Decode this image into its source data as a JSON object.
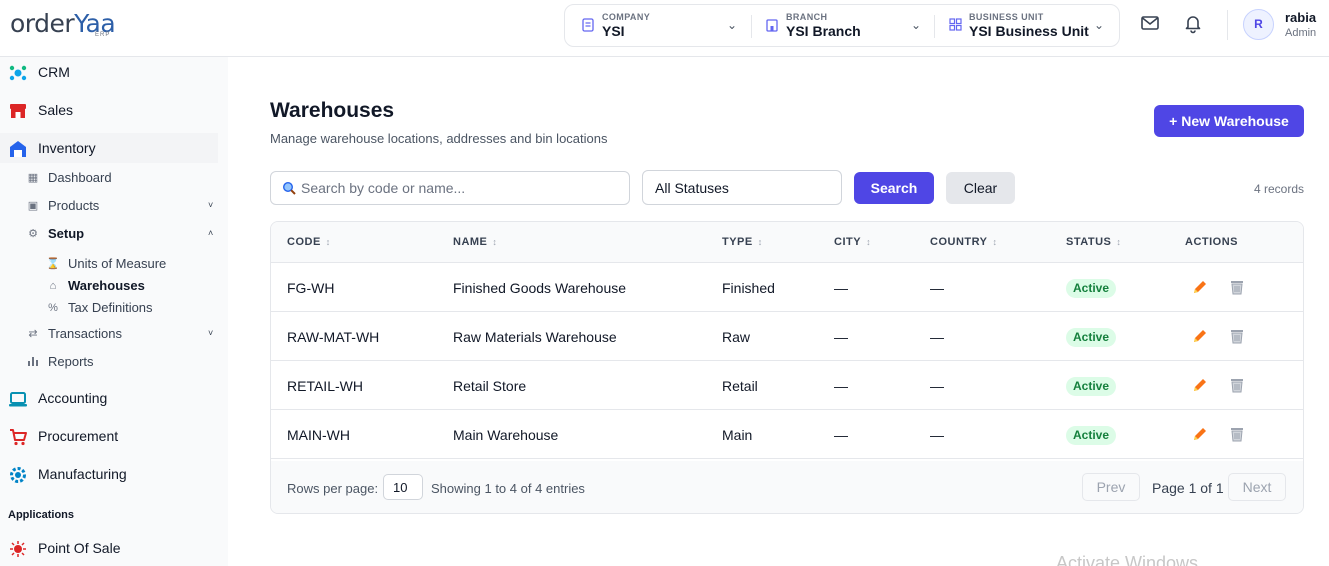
{
  "brand": {
    "logo_prefix": "order",
    "logo_suffix": "Yaa",
    "logo_sub": "ERP"
  },
  "context": [
    {
      "caption": "COMPANY",
      "value": "YSI",
      "icon": "document-icon"
    },
    {
      "caption": "BRANCH",
      "value": "YSI Branch",
      "icon": "building-icon"
    },
    {
      "caption": "BUSINESS UNIT",
      "value": "YSI Business Unit",
      "icon": "grid-icon"
    }
  ],
  "user": {
    "initial": "R",
    "name": "rabia",
    "role": "Admin"
  },
  "sidebar": {
    "modules": [
      {
        "label": "CRM",
        "icon": "crm-icon"
      },
      {
        "label": "Sales",
        "icon": "store-icon"
      },
      {
        "label": "Inventory",
        "icon": "inventory-icon"
      },
      {
        "label": "Accounting",
        "icon": "laptop-icon"
      },
      {
        "label": "Procurement",
        "icon": "cart-icon"
      },
      {
        "label": "Manufacturing",
        "icon": "gear-icon"
      }
    ],
    "inventory_items": [
      {
        "label": "Dashboard",
        "icon": "dashboard-icon"
      },
      {
        "label": "Products",
        "icon": "box-icon",
        "chevron": "˅"
      },
      {
        "label": "Setup",
        "icon": "settings-icon",
        "chevron": "˄"
      },
      {
        "label": "Transactions",
        "icon": "arrows-icon",
        "chevron": "˅"
      },
      {
        "label": "Reports",
        "icon": "bar-chart-icon"
      }
    ],
    "setup_items": [
      {
        "label": "Units of Measure",
        "icon": "hourglass-icon"
      },
      {
        "label": "Warehouses",
        "icon": "warehouse-icon"
      },
      {
        "label": "Tax Definitions",
        "icon": "percent-icon"
      }
    ],
    "applications_label": "Applications",
    "applications": [
      {
        "label": "Point Of Sale",
        "icon": "pos-icon"
      }
    ]
  },
  "page": {
    "title": "Warehouses",
    "subtitle": "Manage warehouse locations, addresses and bin locations",
    "new_button": "+ New Warehouse"
  },
  "filters": {
    "search_placeholder": "Search by code or name...",
    "status_value": "All Statuses",
    "search_button": "Search",
    "clear_button": "Clear",
    "record_count": "4 records"
  },
  "table": {
    "columns": [
      "CODE",
      "NAME",
      "TYPE",
      "CITY",
      "COUNTRY",
      "STATUS",
      "ACTIONS"
    ],
    "sort_glyph": "↕",
    "rows": [
      {
        "code": "FG-WH",
        "name": "Finished Goods Warehouse",
        "type": "Finished",
        "city": "—",
        "country": "—",
        "status": "Active"
      },
      {
        "code": "RAW-MAT-WH",
        "name": "Raw Materials Warehouse",
        "type": "Raw",
        "city": "—",
        "country": "—",
        "status": "Active"
      },
      {
        "code": "RETAIL-WH",
        "name": "Retail Store",
        "type": "Retail",
        "city": "—",
        "country": "—",
        "status": "Active"
      },
      {
        "code": "MAIN-WH",
        "name": "Main Warehouse",
        "type": "Main",
        "city": "—",
        "country": "—",
        "status": "Active"
      }
    ]
  },
  "pagination": {
    "rows_per_page_label": "Rows per page:",
    "rows_per_page": "10",
    "showing": "Showing 1 to 4 of 4 entries",
    "prev": "Prev",
    "page_text": "Page 1 of 1",
    "next": "Next"
  },
  "watermark": "Activate Windows",
  "colors": {
    "accent": "#4f46e5",
    "active_badge_bg": "#dcfce7",
    "active_badge_text": "#15803d",
    "edit": "#f97316"
  }
}
